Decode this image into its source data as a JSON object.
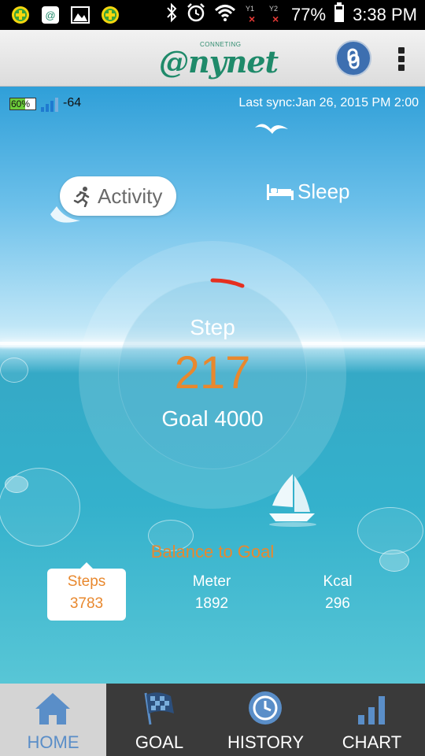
{
  "status_bar": {
    "battery_percent": "77%",
    "time": "3:38 PM",
    "sim1": "Y1",
    "sim2": "Y2",
    "left_icons": [
      "plus-badge-icon",
      "mail-app-icon",
      "gallery-icon",
      "plus-badge-icon"
    ],
    "right_icons": [
      "bluetooth-icon",
      "alarm-icon",
      "wifi-icon",
      "sim-off-icon",
      "sim-off-icon",
      "battery-icon"
    ]
  },
  "header": {
    "logo_tagline": "CONNETING",
    "logo_text": "@nynet",
    "link_icon": "link-icon",
    "menu_icon": "overflow-menu-icon"
  },
  "device": {
    "battery_level": "60%",
    "battery_fill_fraction": 0.6,
    "signal": "-64",
    "last_sync": "Last sync:Jan 26, 2015 PM 2:00"
  },
  "mode_tabs": {
    "activity": "Activity",
    "sleep": "Sleep"
  },
  "progress": {
    "step_label": "Step",
    "steps": "217",
    "goal_label": "Goal 4000",
    "progress_fraction": 0.054
  },
  "balance": {
    "title": "Balance to Goal",
    "stats": [
      {
        "label": "Steps",
        "value": "3783"
      },
      {
        "label": "Meter",
        "value": "1892"
      },
      {
        "label": "Kcal",
        "value": "296"
      }
    ]
  },
  "nav": {
    "items": [
      {
        "label": "HOME",
        "icon": "home-icon"
      },
      {
        "label": "GOAL",
        "icon": "checkered-flag-icon"
      },
      {
        "label": "HISTORY",
        "icon": "history-clock-icon"
      },
      {
        "label": "CHART",
        "icon": "bar-chart-icon"
      }
    ]
  },
  "colors": {
    "accent_orange": "#e8882e",
    "nav_blue": "#5a8ec8",
    "brand_green": "#1f8a6a",
    "progress_red": "#e53020"
  }
}
